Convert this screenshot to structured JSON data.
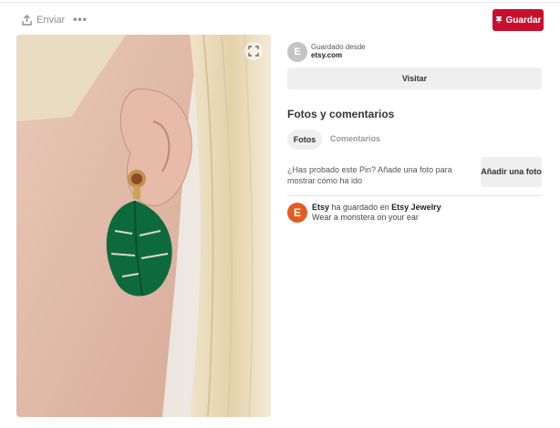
{
  "toolbar": {
    "send_label": "Enviar",
    "more_icon": "ellipsis-icon",
    "save_label": "Guardar",
    "save_icon": "pin-icon",
    "accent_color": "#c8102e"
  },
  "pin": {
    "image_description_icon": "photo",
    "expand_icon": "expand-icon"
  },
  "source": {
    "avatar_letter": "E",
    "saved_from_label": "Guardado desde",
    "domain": "etsy.com",
    "visit_label": "Visitar"
  },
  "photos_comments": {
    "title": "Fotos y comentarios",
    "tabs": [
      {
        "label": "Fotos",
        "active": true
      },
      {
        "label": "Comentarios",
        "active": false
      }
    ],
    "prompt": "¿Has probado este Pin? Añade una foto para mostrar cómo ha ido",
    "add_photo_label": "Añadir una foto"
  },
  "activity": {
    "avatar_letter": "E",
    "avatar_color": "#e35d1f",
    "user": "Etsy",
    "action": "ha guardado en",
    "board": "Etsy Jewelry",
    "description": "Wear a monstera on your ear"
  }
}
